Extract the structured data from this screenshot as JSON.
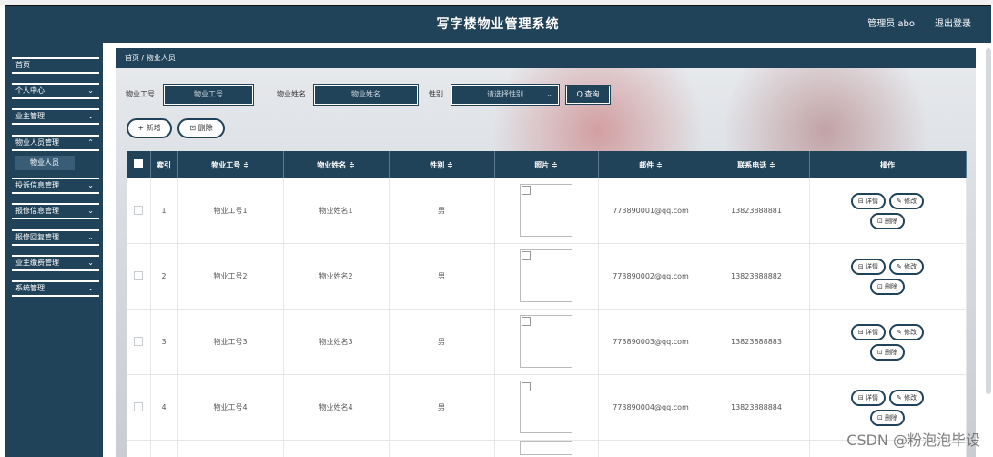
{
  "header": {
    "title": "写字楼物业管理系统",
    "user": "管理员 abo",
    "logout": "退出登录"
  },
  "sidebar": {
    "home": "首页",
    "items": [
      {
        "label": "个人中心"
      },
      {
        "label": "业主管理"
      },
      {
        "label": "物业人员管理"
      },
      {
        "label": "投诉信息管理"
      },
      {
        "label": "报修信息管理"
      },
      {
        "label": "报修回复管理"
      },
      {
        "label": "业主缴费管理"
      },
      {
        "label": "系统管理"
      }
    ],
    "subitem": "物业人员",
    "chevron": "chevron-down-icon"
  },
  "breadcrumb": {
    "home": "首页",
    "sep": "/",
    "current": "物业人员"
  },
  "filters": {
    "job_no_label": "物业工号",
    "job_no_placeholder": "物业工号",
    "name_label": "物业姓名",
    "name_placeholder": "物业姓名",
    "gender_label": "性别",
    "gender_placeholder": "请选择性别",
    "search_label": "Q 查询"
  },
  "toolbar": {
    "add": "+ 新增",
    "delete": "⊡ 删除"
  },
  "table": {
    "headers": [
      "索引",
      "物业工号 ≑",
      "物业姓名 ≑",
      "性别 ≑",
      "照片 ≑",
      "邮件 ≑",
      "联系电话 ≑",
      "操作"
    ],
    "rows": [
      {
        "index": "1",
        "job_no": "物业工号1",
        "name": "物业姓名1",
        "gender": "男",
        "email": "773890001@qq.com",
        "phone": "13823888881"
      },
      {
        "index": "2",
        "job_no": "物业工号2",
        "name": "物业姓名2",
        "gender": "男",
        "email": "773890002@qq.com",
        "phone": "13823888882"
      },
      {
        "index": "3",
        "job_no": "物业工号3",
        "name": "物业姓名3",
        "gender": "男",
        "email": "773890003@qq.com",
        "phone": "13823888883"
      },
      {
        "index": "4",
        "job_no": "物业工号4",
        "name": "物业姓名4",
        "gender": "男",
        "email": "773890004@qq.com",
        "phone": "13823888884"
      }
    ],
    "actions": {
      "detail": "⊟ 详情",
      "edit": "✎ 修改",
      "delete": "⊡ 删除"
    }
  },
  "watermark": "CSDN @粉泡泡毕设",
  "colors": {
    "primary": "#21435a",
    "background": "#ffffff"
  }
}
